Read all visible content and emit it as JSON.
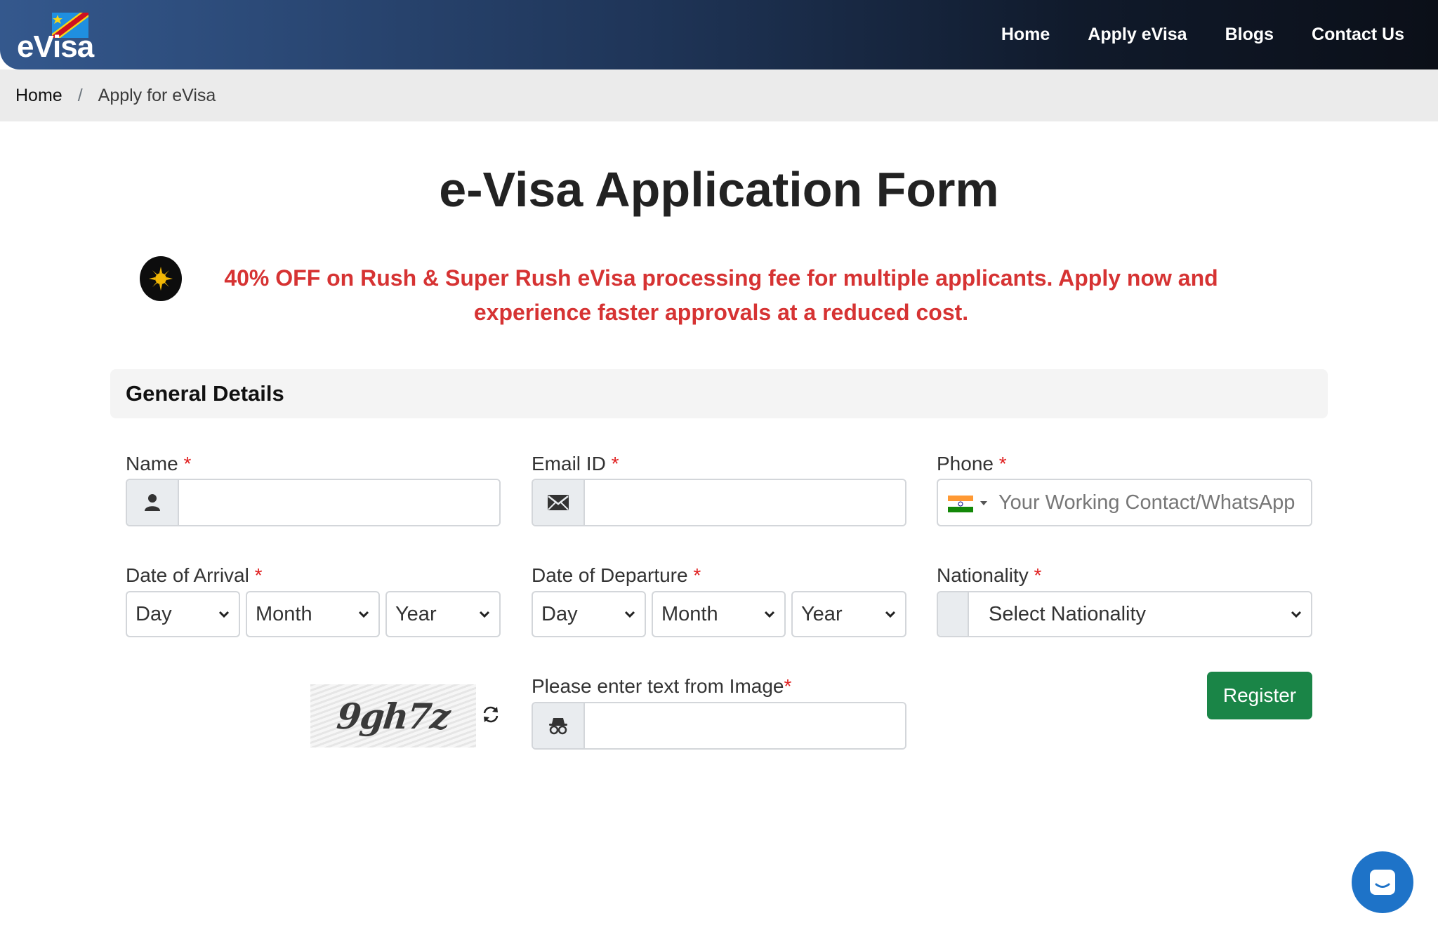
{
  "header": {
    "logo_text": "eVisa",
    "nav": [
      "Home",
      "Apply eVisa",
      "Blogs",
      "Contact Us"
    ]
  },
  "breadcrumb": {
    "home": "Home",
    "separator": "/",
    "current": "Apply for eVisa"
  },
  "page": {
    "title": "e-Visa Application Form",
    "promo": "40% OFF on Rush & Super Rush eVisa processing fee for multiple applicants. Apply now and experience faster approvals at a reduced cost."
  },
  "form": {
    "section_title": "General Details",
    "required_mark": "*",
    "name": {
      "label": "Name",
      "value": ""
    },
    "email": {
      "label": "Email ID",
      "value": ""
    },
    "phone": {
      "label": "Phone",
      "placeholder": "Your Working Contact/WhatsApp",
      "country": "India"
    },
    "arrival": {
      "label": "Date of Arrival",
      "day": "Day",
      "month": "Month",
      "year": "Year"
    },
    "departure": {
      "label": "Date of Departure",
      "day": "Day",
      "month": "Month",
      "year": "Year"
    },
    "nationality": {
      "label": "Nationality",
      "selected": "Select Nationality"
    },
    "captcha": {
      "label": "Please enter text from Image",
      "image_text": "9gh7z",
      "value": ""
    },
    "submit_label": "Register"
  },
  "colors": {
    "header_start": "#34588d",
    "header_end": "#0b0f18",
    "promo": "#d63333",
    "required": "#e02020",
    "register": "#1a8547",
    "chat": "#1e73c8"
  }
}
